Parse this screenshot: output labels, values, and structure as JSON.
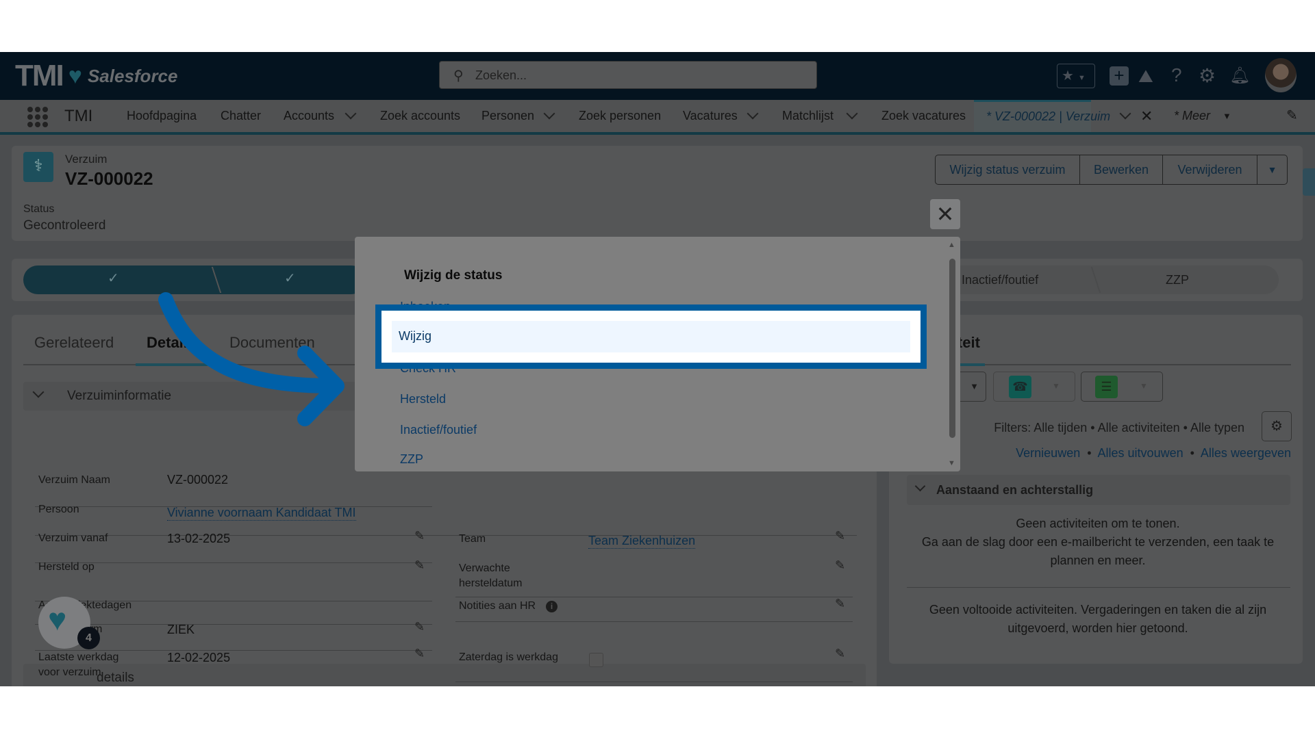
{
  "header": {
    "logo_text": "TMI",
    "brand": "Salesforce",
    "search_placeholder": "Zoeken...",
    "icons": [
      "star-icon",
      "add-icon",
      "trailhead-icon",
      "help-icon",
      "gear-icon",
      "bell-icon",
      "avatar"
    ]
  },
  "nav": {
    "app_name": "TMI",
    "items": [
      "Hoofdpagina",
      "Chatter",
      "Accounts",
      "Zoek accounts",
      "Personen",
      "Zoek personen",
      "Vacatures",
      "Matchlijst",
      "Zoek vacatures"
    ],
    "active_tab": "* VZ-000022 | Verzuim",
    "more": "* Meer"
  },
  "record": {
    "object": "Verzuim",
    "name": "VZ-000022",
    "status_label": "Status",
    "status_value": "Gecontroleerd",
    "buttons": [
      "Wijzig status verzuim",
      "Bewerken",
      "Verwijderen"
    ]
  },
  "path": {
    "stages": [
      "Inactief/foutief",
      "ZZP"
    ]
  },
  "tabs": [
    "Gerelateerd",
    "Details",
    "Documenten"
  ],
  "details": {
    "section1": "Verzuiminformatie",
    "left": [
      {
        "label": "Verzuim Naam",
        "value": "VZ-000022"
      },
      {
        "label": "Persoon",
        "value": "Vivianne voornaam Kandidaat TMI"
      },
      {
        "label": "Verzuim vanaf",
        "value": "13-02-2025"
      },
      {
        "label": "Hersteld op",
        "value": ""
      },
      {
        "label": "Aantal ziektedagen",
        "value": ""
      },
      {
        "label": "Verzuimvorm",
        "value": "ZIEK"
      }
    ],
    "right": [
      {
        "label": "Team",
        "value": "Team Ziekenhuizen"
      },
      {
        "label": "Verwachte hersteldatum",
        "value": ""
      },
      {
        "label": "Notities aan HR",
        "value": ""
      }
    ],
    "section2": "details",
    "section2_rows": [
      {
        "label": "Laatste werkdag voor verzuim",
        "value": "12-02-2025"
      },
      {
        "label": "Zaterdag is werkdag",
        "checked": false
      }
    ]
  },
  "activity": {
    "tab": "Activiteit",
    "filters": "Filters: Alle tijden • Alle activiteiten • Alle typen",
    "links": [
      "Vernieuwen",
      "Alles uitvouwen",
      "Alles weergeven"
    ],
    "section": "Aanstaand en achterstallig",
    "empty1": "Geen activiteiten om te tonen.",
    "empty2": "Ga aan de slag door een e-mailbericht te verzenden, een taak te plannen en meer.",
    "empty3": "Geen voltooide activiteiten. Vergaderingen en taken die al zijn uitgevoerd, worden hier getoond."
  },
  "modal": {
    "title": "Wijzig de status",
    "items": [
      "Inboeken",
      "Wijzig",
      "Check HR",
      "Hersteld",
      "Inactief/foutief",
      "ZZP"
    ],
    "highlighted": "Wijzig"
  },
  "floating": {
    "badge": "4"
  },
  "colors": {
    "highlight_border": "#005a9a",
    "arrow": "#0060a8",
    "header": "#04131f"
  }
}
